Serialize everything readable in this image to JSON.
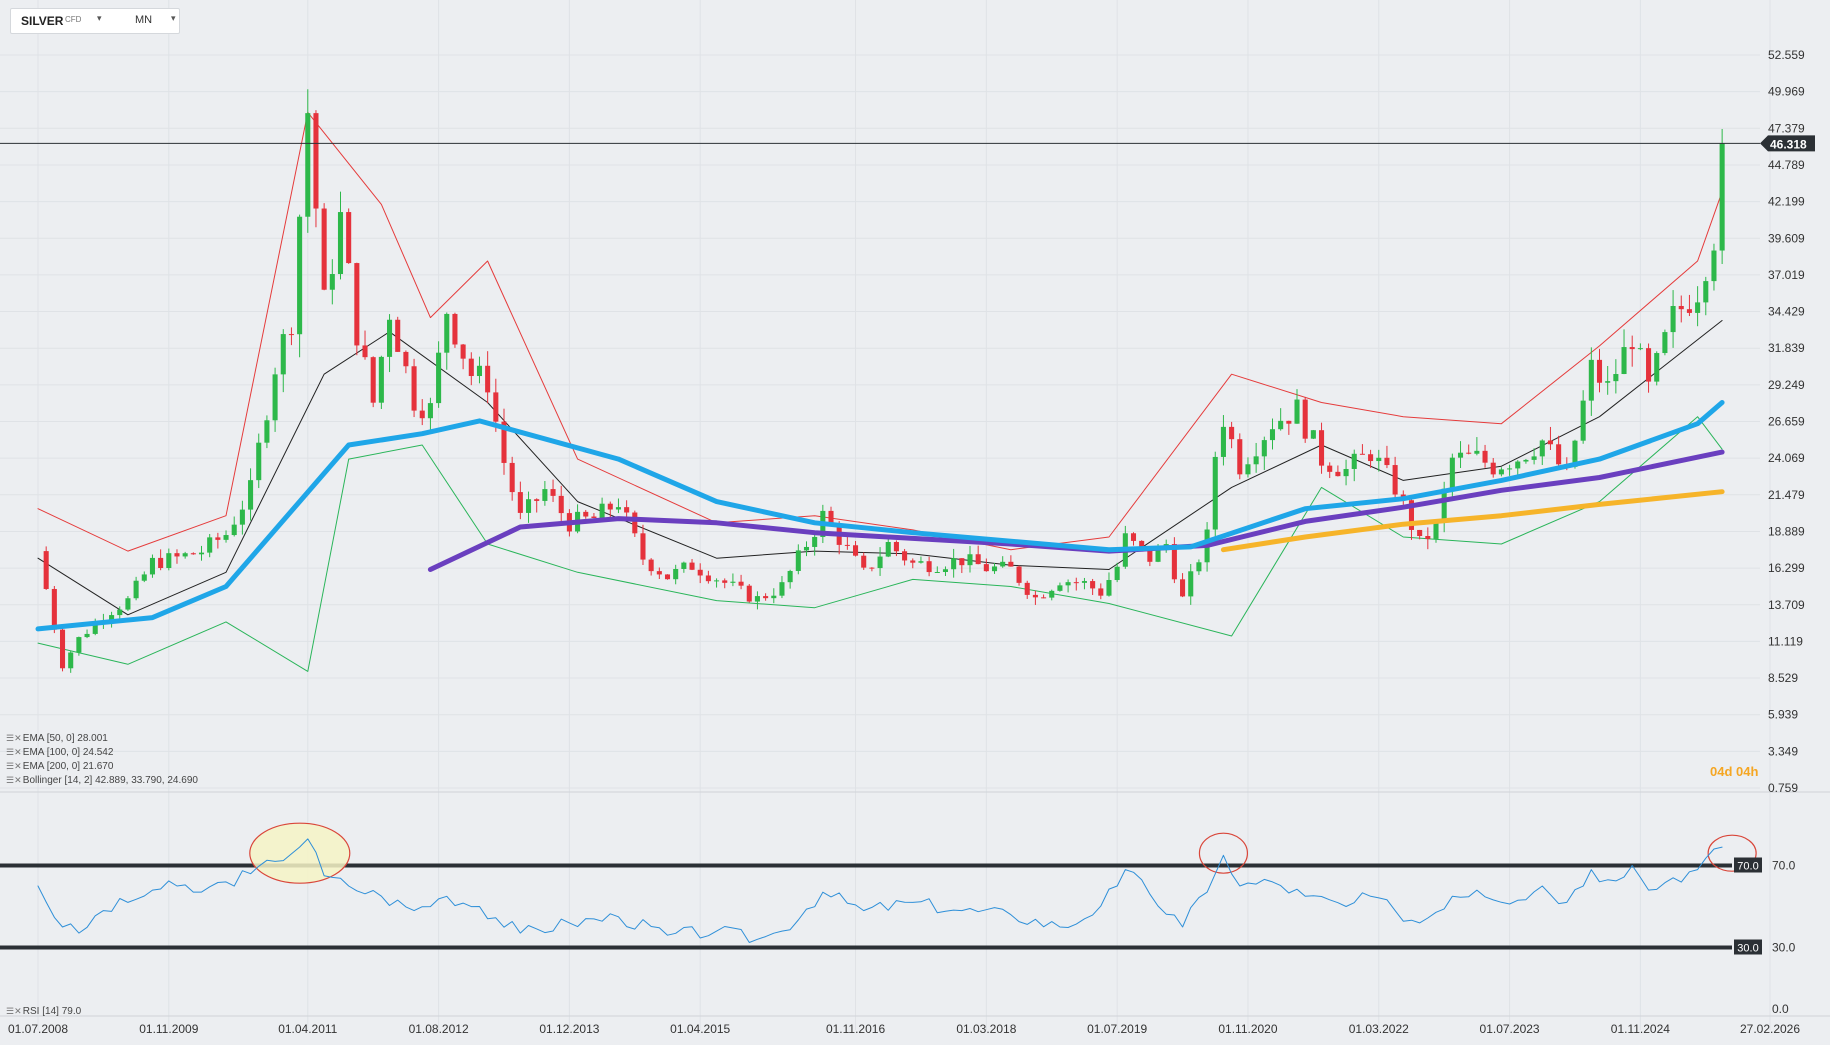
{
  "header": {
    "symbol": "SILVER",
    "symbol_type": "CFD",
    "timeframe": "MN",
    "symbol_caret": "▾",
    "timeframe_caret": "▾"
  },
  "indicator_legend": [
    {
      "name": "EMA",
      "params": "[50,  0]",
      "value": "28.001"
    },
    {
      "name": "EMA",
      "params": "[100,  0]",
      "value": "24.542"
    },
    {
      "name": "EMA",
      "params": "[200,  0]",
      "value": "21.670"
    },
    {
      "name": "Bollinger",
      "params": "[14, 2]",
      "value": "42.889,  33.790,  24.690"
    }
  ],
  "rsi_legend": {
    "name": "RSI",
    "params": "[14]",
    "value": "79.0"
  },
  "countdown": "04d 04h",
  "current_price_label": "46.318",
  "colors": {
    "bull": "#2db84a",
    "bear": "#e5323c",
    "ema50": "#1fa6e8",
    "ema100": "#6a3fbf",
    "ema200": "#f6b42a",
    "boll_upper": "#e53b3b",
    "boll_mid": "#222222",
    "boll_lower": "#2ab55a",
    "rsi": "#2e8fd8",
    "highlight_fill": "#f6f3c6",
    "highlight_stroke": "#d9463a"
  },
  "chart_data": [
    {
      "type": "candlestick",
      "title": "",
      "instrument": "SILVER",
      "timeframe": "MN",
      "price_axis_ticks": [
        "52.559",
        "49.969",
        "47.379",
        "44.789",
        "42.199",
        "39.609",
        "37.019",
        "34.429",
        "31.839",
        "29.249",
        "26.659",
        "24.069",
        "21.479",
        "18.889",
        "16.299",
        "13.709",
        "11.119",
        "8.529",
        "5.939",
        "3.349",
        "0.759"
      ],
      "x_axis_ticks": [
        "01.07.2008",
        "01.11.2009",
        "01.04.2011",
        "01.08.2012",
        "01.12.2013",
        "01.04.2015",
        "01.11.2016",
        "01.03.2018",
        "01.07.2019",
        "01.11.2020",
        "01.03.2022",
        "01.07.2023",
        "01.11.2024",
        "27.02.2026"
      ],
      "x_range": [
        "2008-07",
        "2026-02"
      ],
      "y_range": [
        0.759,
        53.5
      ],
      "last_price": 46.318,
      "close_path": [
        [
          "2008-07",
          17.5
        ],
        [
          "2008-10",
          9.5
        ],
        [
          "2008-12",
          11.3
        ],
        [
          "2009-03",
          13.0
        ],
        [
          "2009-06",
          14.0
        ],
        [
          "2009-09",
          16.7
        ],
        [
          "2009-12",
          17.0
        ],
        [
          "2010-03",
          17.5
        ],
        [
          "2010-06",
          18.7
        ],
        [
          "2010-09",
          21.8
        ],
        [
          "2010-12",
          30.6
        ],
        [
          "2011-02",
          34.0
        ],
        [
          "2011-04",
          48.6
        ],
        [
          "2011-06",
          35.0
        ],
        [
          "2011-08",
          41.0
        ],
        [
          "2011-10",
          33.0
        ],
        [
          "2011-12",
          28.0
        ],
        [
          "2012-02",
          34.5
        ],
        [
          "2012-05",
          28.2
        ],
        [
          "2012-07",
          27.5
        ],
        [
          "2012-09",
          34.6
        ],
        [
          "2012-12",
          30.0
        ],
        [
          "2013-02",
          29.5
        ],
        [
          "2013-04",
          23.8
        ],
        [
          "2013-06",
          19.8
        ],
        [
          "2013-09",
          21.8
        ],
        [
          "2013-12",
          19.5
        ],
        [
          "2014-03",
          19.8
        ],
        [
          "2014-06",
          21.0
        ],
        [
          "2014-09",
          17.0
        ],
        [
          "2014-12",
          15.7
        ],
        [
          "2015-03",
          16.5
        ],
        [
          "2015-06",
          15.6
        ],
        [
          "2015-09",
          14.6
        ],
        [
          "2015-11",
          14.1
        ],
        [
          "2016-02",
          15.0
        ],
        [
          "2016-07",
          20.0
        ],
        [
          "2016-10",
          17.6
        ],
        [
          "2016-12",
          15.9
        ],
        [
          "2017-03",
          18.0
        ],
        [
          "2017-06",
          16.6
        ],
        [
          "2017-09",
          16.6
        ],
        [
          "2017-12",
          16.9
        ],
        [
          "2018-03",
          16.3
        ],
        [
          "2018-06",
          16.2
        ],
        [
          "2018-09",
          14.2
        ],
        [
          "2018-12",
          15.5
        ],
        [
          "2019-03",
          15.2
        ],
        [
          "2019-05",
          14.6
        ],
        [
          "2019-07",
          16.4
        ],
        [
          "2019-08",
          18.4
        ],
        [
          "2019-11",
          17.0
        ],
        [
          "2020-01",
          18.0
        ],
        [
          "2020-03",
          14.1
        ],
        [
          "2020-06",
          18.5
        ],
        [
          "2020-07",
          24.3
        ],
        [
          "2020-08",
          26.9
        ],
        [
          "2020-10",
          23.6
        ],
        [
          "2021-01",
          25.8
        ],
        [
          "2021-02",
          26.6
        ],
        [
          "2021-05",
          27.5
        ],
        [
          "2021-08",
          24.0
        ],
        [
          "2021-11",
          23.2
        ],
        [
          "2022-02",
          24.5
        ],
        [
          "2022-05",
          22.0
        ],
        [
          "2022-08",
          18.0
        ],
        [
          "2022-10",
          19.2
        ],
        [
          "2022-12",
          24.0
        ],
        [
          "2023-03",
          24.1
        ],
        [
          "2023-05",
          23.5
        ],
        [
          "2023-08",
          24.1
        ],
        [
          "2023-11",
          25.3
        ],
        [
          "2024-02",
          22.8
        ],
        [
          "2024-05",
          30.4
        ],
        [
          "2024-07",
          29.0
        ],
        [
          "2024-10",
          32.7
        ],
        [
          "2024-12",
          28.9
        ],
        [
          "2025-03",
          34.0
        ],
        [
          "2025-06",
          36.0
        ],
        [
          "2025-08",
          39.8
        ],
        [
          "2025-09",
          46.3
        ]
      ],
      "indicators": {
        "ema_50": [
          [
            "2008-07",
            12.0
          ],
          [
            "2009-09",
            12.8
          ],
          [
            "2010-06",
            15.0
          ],
          [
            "2011-03",
            21.0
          ],
          [
            "2011-09",
            25.0
          ],
          [
            "2012-06",
            25.8
          ],
          [
            "2013-01",
            26.7
          ],
          [
            "2014-06",
            24.0
          ],
          [
            "2015-06",
            21.0
          ],
          [
            "2016-06",
            19.5
          ],
          [
            "2017-06",
            18.8
          ],
          [
            "2018-06",
            18.2
          ],
          [
            "2019-06",
            17.6
          ],
          [
            "2020-04",
            17.8
          ],
          [
            "2021-06",
            20.5
          ],
          [
            "2022-06",
            21.2
          ],
          [
            "2023-06",
            22.5
          ],
          [
            "2024-06",
            24.0
          ],
          [
            "2025-06",
            26.5
          ],
          [
            "2025-09",
            28.0
          ]
        ],
        "ema_100": [
          [
            "2012-07",
            16.2
          ],
          [
            "2013-06",
            19.2
          ],
          [
            "2014-06",
            19.8
          ],
          [
            "2015-06",
            19.5
          ],
          [
            "2016-06",
            18.8
          ],
          [
            "2017-06",
            18.4
          ],
          [
            "2018-06",
            18.0
          ],
          [
            "2019-06",
            17.5
          ],
          [
            "2020-06",
            17.9
          ],
          [
            "2021-06",
            19.6
          ],
          [
            "2022-06",
            20.6
          ],
          [
            "2023-06",
            21.8
          ],
          [
            "2024-06",
            22.7
          ],
          [
            "2025-09",
            24.5
          ]
        ],
        "ema_200": [
          [
            "2020-08",
            17.6
          ],
          [
            "2021-06",
            18.5
          ],
          [
            "2022-06",
            19.4
          ],
          [
            "2023-06",
            20.0
          ],
          [
            "2024-06",
            20.8
          ],
          [
            "2025-09",
            21.7
          ]
        ],
        "bollinger_upper": [
          [
            "2008-07",
            20.5
          ],
          [
            "2009-06",
            17.5
          ],
          [
            "2010-06",
            20.0
          ],
          [
            "2011-04",
            48.5
          ],
          [
            "2012-01",
            42.0
          ],
          [
            "2012-07",
            34.0
          ],
          [
            "2013-02",
            38.0
          ],
          [
            "2014-01",
            24.0
          ],
          [
            "2015-06",
            19.5
          ],
          [
            "2016-06",
            20.0
          ],
          [
            "2017-06",
            19.0
          ],
          [
            "2018-06",
            17.6
          ],
          [
            "2019-06",
            18.5
          ],
          [
            "2020-09",
            30.0
          ],
          [
            "2021-08",
            28.0
          ],
          [
            "2022-06",
            27.0
          ],
          [
            "2023-06",
            26.5
          ],
          [
            "2024-06",
            32.0
          ],
          [
            "2025-06",
            38.0
          ],
          [
            "2025-09",
            42.9
          ]
        ],
        "bollinger_middle": [
          [
            "2008-07",
            17.0
          ],
          [
            "2009-06",
            13.0
          ],
          [
            "2010-06",
            16.0
          ],
          [
            "2011-06",
            30.0
          ],
          [
            "2012-02",
            33.0
          ],
          [
            "2013-02",
            28.0
          ],
          [
            "2014-01",
            21.0
          ],
          [
            "2015-06",
            17.0
          ],
          [
            "2016-06",
            17.5
          ],
          [
            "2017-06",
            17.3
          ],
          [
            "2018-06",
            16.5
          ],
          [
            "2019-06",
            16.2
          ],
          [
            "2020-09",
            22.0
          ],
          [
            "2021-08",
            25.0
          ],
          [
            "2022-06",
            22.5
          ],
          [
            "2023-06",
            23.5
          ],
          [
            "2024-06",
            27.0
          ],
          [
            "2025-09",
            33.8
          ]
        ],
        "bollinger_lower": [
          [
            "2008-07",
            11.0
          ],
          [
            "2009-06",
            9.5
          ],
          [
            "2010-06",
            12.5
          ],
          [
            "2011-04",
            9.0
          ],
          [
            "2011-09",
            24.0
          ],
          [
            "2012-06",
            25.0
          ],
          [
            "2013-02",
            18.0
          ],
          [
            "2014-01",
            16.0
          ],
          [
            "2015-06",
            14.0
          ],
          [
            "2016-06",
            13.5
          ],
          [
            "2017-06",
            15.5
          ],
          [
            "2018-06",
            15.0
          ],
          [
            "2019-06",
            13.8
          ],
          [
            "2020-09",
            11.5
          ],
          [
            "2021-08",
            22.0
          ],
          [
            "2022-06",
            18.5
          ],
          [
            "2023-06",
            18.0
          ],
          [
            "2024-06",
            21.0
          ],
          [
            "2025-06",
            27.0
          ],
          [
            "2025-09",
            24.7
          ]
        ]
      }
    },
    {
      "type": "line",
      "title": "",
      "indicator": "RSI",
      "params": "[14]",
      "y_axis_ticks": [
        "70.0",
        "30.0",
        "0.0"
      ],
      "y_range": [
        0,
        100
      ],
      "levels": [
        70,
        30
      ],
      "last_value": 79.0,
      "values": [
        [
          "2008-07",
          60
        ],
        [
          "2008-10",
          40
        ],
        [
          "2008-12",
          37
        ],
        [
          "2009-03",
          48
        ],
        [
          "2009-06",
          52
        ],
        [
          "2009-09",
          58
        ],
        [
          "2009-12",
          60
        ],
        [
          "2010-03",
          57
        ],
        [
          "2010-06",
          62
        ],
        [
          "2010-09",
          66
        ],
        [
          "2010-12",
          72
        ],
        [
          "2011-04",
          83
        ],
        [
          "2011-06",
          65
        ],
        [
          "2011-09",
          60
        ],
        [
          "2012-01",
          55
        ],
        [
          "2012-05",
          48
        ],
        [
          "2012-09",
          55
        ],
        [
          "2013-01",
          50
        ],
        [
          "2013-06",
          37
        ],
        [
          "2013-12",
          42
        ],
        [
          "2014-06",
          45
        ],
        [
          "2014-12",
          36
        ],
        [
          "2015-06",
          38
        ],
        [
          "2015-11",
          34
        ],
        [
          "2016-02",
          38
        ],
        [
          "2016-07",
          57
        ],
        [
          "2016-12",
          48
        ],
        [
          "2017-06",
          52
        ],
        [
          "2017-12",
          48
        ],
        [
          "2018-06",
          46
        ],
        [
          "2018-12",
          40
        ],
        [
          "2019-03",
          44
        ],
        [
          "2019-07",
          60
        ],
        [
          "2019-08",
          68
        ],
        [
          "2019-11",
          56
        ],
        [
          "2020-03",
          40
        ],
        [
          "2020-07",
          66
        ],
        [
          "2020-08",
          75
        ],
        [
          "2020-10",
          60
        ],
        [
          "2021-02",
          62
        ],
        [
          "2021-06",
          55
        ],
        [
          "2021-11",
          50
        ],
        [
          "2022-02",
          55
        ],
        [
          "2022-05",
          48
        ],
        [
          "2022-08",
          42
        ],
        [
          "2022-12",
          55
        ],
        [
          "2023-03",
          58
        ],
        [
          "2023-08",
          53
        ],
        [
          "2023-11",
          60
        ],
        [
          "2024-02",
          52
        ],
        [
          "2024-05",
          68
        ],
        [
          "2024-07",
          63
        ],
        [
          "2024-10",
          70
        ],
        [
          "2024-12",
          58
        ],
        [
          "2025-03",
          64
        ],
        [
          "2025-06",
          68
        ],
        [
          "2025-09",
          79
        ]
      ],
      "annotations": [
        "circle around RSI peak above 70 (2011)",
        "circle around RSI peak above 70 (2020)",
        "circle around RSI peak above 70 (2025)"
      ]
    }
  ]
}
